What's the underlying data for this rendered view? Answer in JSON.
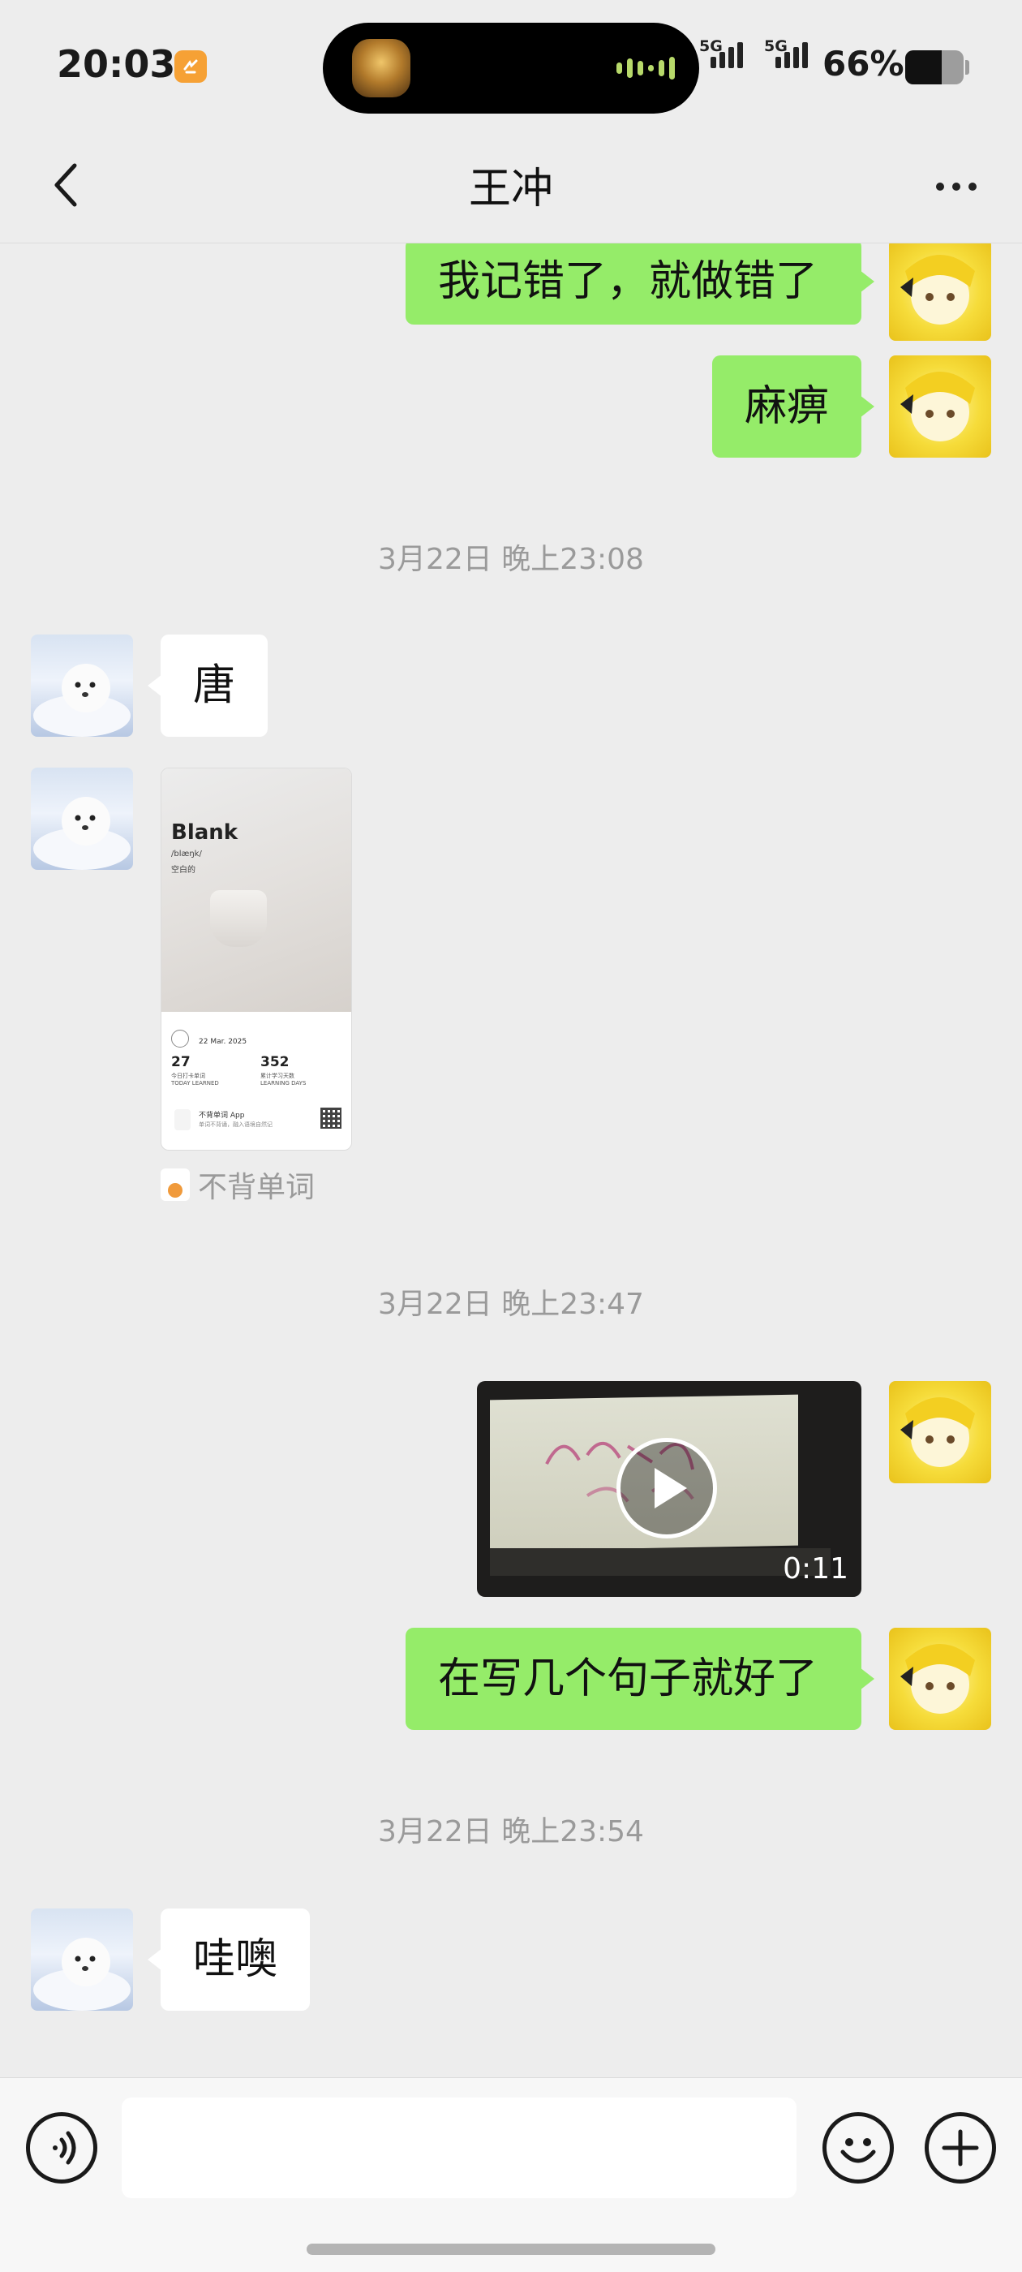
{
  "status_bar": {
    "time": "20:03",
    "network_1": "5G",
    "network_2": "5G",
    "battery": "66%"
  },
  "nav": {
    "title": "王冲"
  },
  "messages": [
    {
      "side": "me",
      "text": "我记错了，就做错了"
    },
    {
      "side": "me",
      "text": "麻痹"
    },
    {
      "timestamp": "3月22日 晚上23:08"
    },
    {
      "side": "other",
      "text": "唐"
    },
    {
      "side": "other",
      "card": {
        "word": "Blank",
        "phonetic": "/blæŋk/",
        "meaning": "空白的",
        "date": "22 Mar. 2025",
        "today_count": "27",
        "today_label": "今日打卡单词",
        "today_label_en": "TODAY LEARNED",
        "days_count": "352",
        "days_label": "累计学习天数",
        "days_label_en": "LEARNING DAYS",
        "app_name": "不背单词 App",
        "app_sub": "单词不背诵，融入语境自然记"
      },
      "source": "不背单词"
    },
    {
      "timestamp": "3月22日 晚上23:47"
    },
    {
      "side": "me",
      "video": {
        "duration": "0:11"
      }
    },
    {
      "side": "me",
      "text": "在写几个句子就好了"
    },
    {
      "timestamp": "3月22日 晚上23:54"
    },
    {
      "side": "other",
      "text": "哇噢"
    }
  ],
  "input": {
    "value": "",
    "placeholder": ""
  },
  "icons": {
    "back": "chevron-left-icon",
    "more": "more-icon",
    "voice": "voice-icon",
    "emoji": "emoji-icon",
    "add": "plus-icon",
    "play": "play-icon"
  },
  "colors": {
    "my_bubble": "#95ec69",
    "their_bubble": "#ffffff",
    "background": "#ededed"
  }
}
